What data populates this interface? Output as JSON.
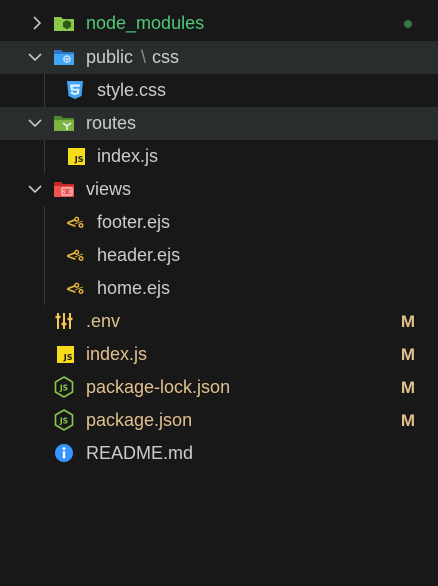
{
  "explorer": {
    "items": [
      {
        "label": "node_modules",
        "badge": ""
      },
      {
        "label": "public",
        "sep": "\\",
        "label2": "css",
        "badge": ""
      },
      {
        "label": "style.css",
        "badge": ""
      },
      {
        "label": "routes",
        "badge": ""
      },
      {
        "label": "index.js",
        "badge": ""
      },
      {
        "label": "views",
        "badge": ""
      },
      {
        "label": "footer.ejs",
        "badge": ""
      },
      {
        "label": "header.ejs",
        "badge": ""
      },
      {
        "label": "home.ejs",
        "badge": ""
      },
      {
        "label": ".env",
        "badge": "M"
      },
      {
        "label": "index.js",
        "badge": "M"
      },
      {
        "label": "package-lock.json",
        "badge": "M"
      },
      {
        "label": "package.json",
        "badge": "M"
      },
      {
        "label": "README.md",
        "badge": ""
      }
    ]
  },
  "icons": {
    "chevron_right": "chevron-right-icon",
    "chevron_down": "chevron-down-icon",
    "node_modules": "node-folder-icon",
    "public": "public-folder-icon",
    "css": "css3-icon",
    "routes": "routes-folder-icon",
    "views": "views-folder-icon",
    "js": "js-icon",
    "ejs": "ejs-icon",
    "env": "env-settings-icon",
    "node": "nodejs-icon",
    "info": "info-icon"
  },
  "colors": {
    "background": "#181818",
    "selected_row": "#2a2d2e",
    "text": "#cccccc",
    "ignored_green": "#4ec979",
    "modified_yellow": "#e2c08d",
    "js_yellow": "#f5de19",
    "ejs_orange": "#e7b33b",
    "css_blue": "#42a5f5",
    "node_green": "#8cc84b",
    "views_red": "#ef5350",
    "info_blue": "#3794ff"
  }
}
